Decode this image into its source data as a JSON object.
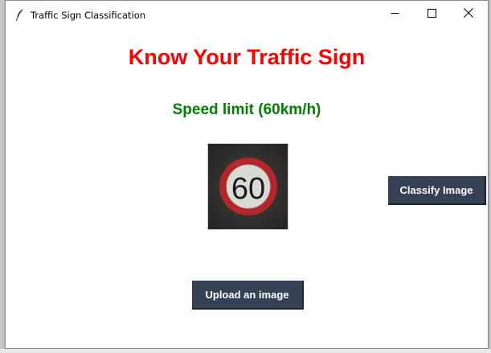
{
  "window": {
    "title": "Traffic Sign Classification",
    "icon": "feather-icon",
    "controls": {
      "minimize": "minimize-icon",
      "maximize": "maximize-icon",
      "close": "close-icon"
    }
  },
  "main": {
    "heading": "Know Your Traffic Sign",
    "heading_color": "#ff0000",
    "prediction": "Speed limit (60km/h)",
    "prediction_color": "#008000",
    "image": {
      "sign_text": "60"
    },
    "buttons": {
      "classify_label": "Classify Image",
      "upload_label": "Upload an image",
      "button_color": "#364156"
    }
  }
}
